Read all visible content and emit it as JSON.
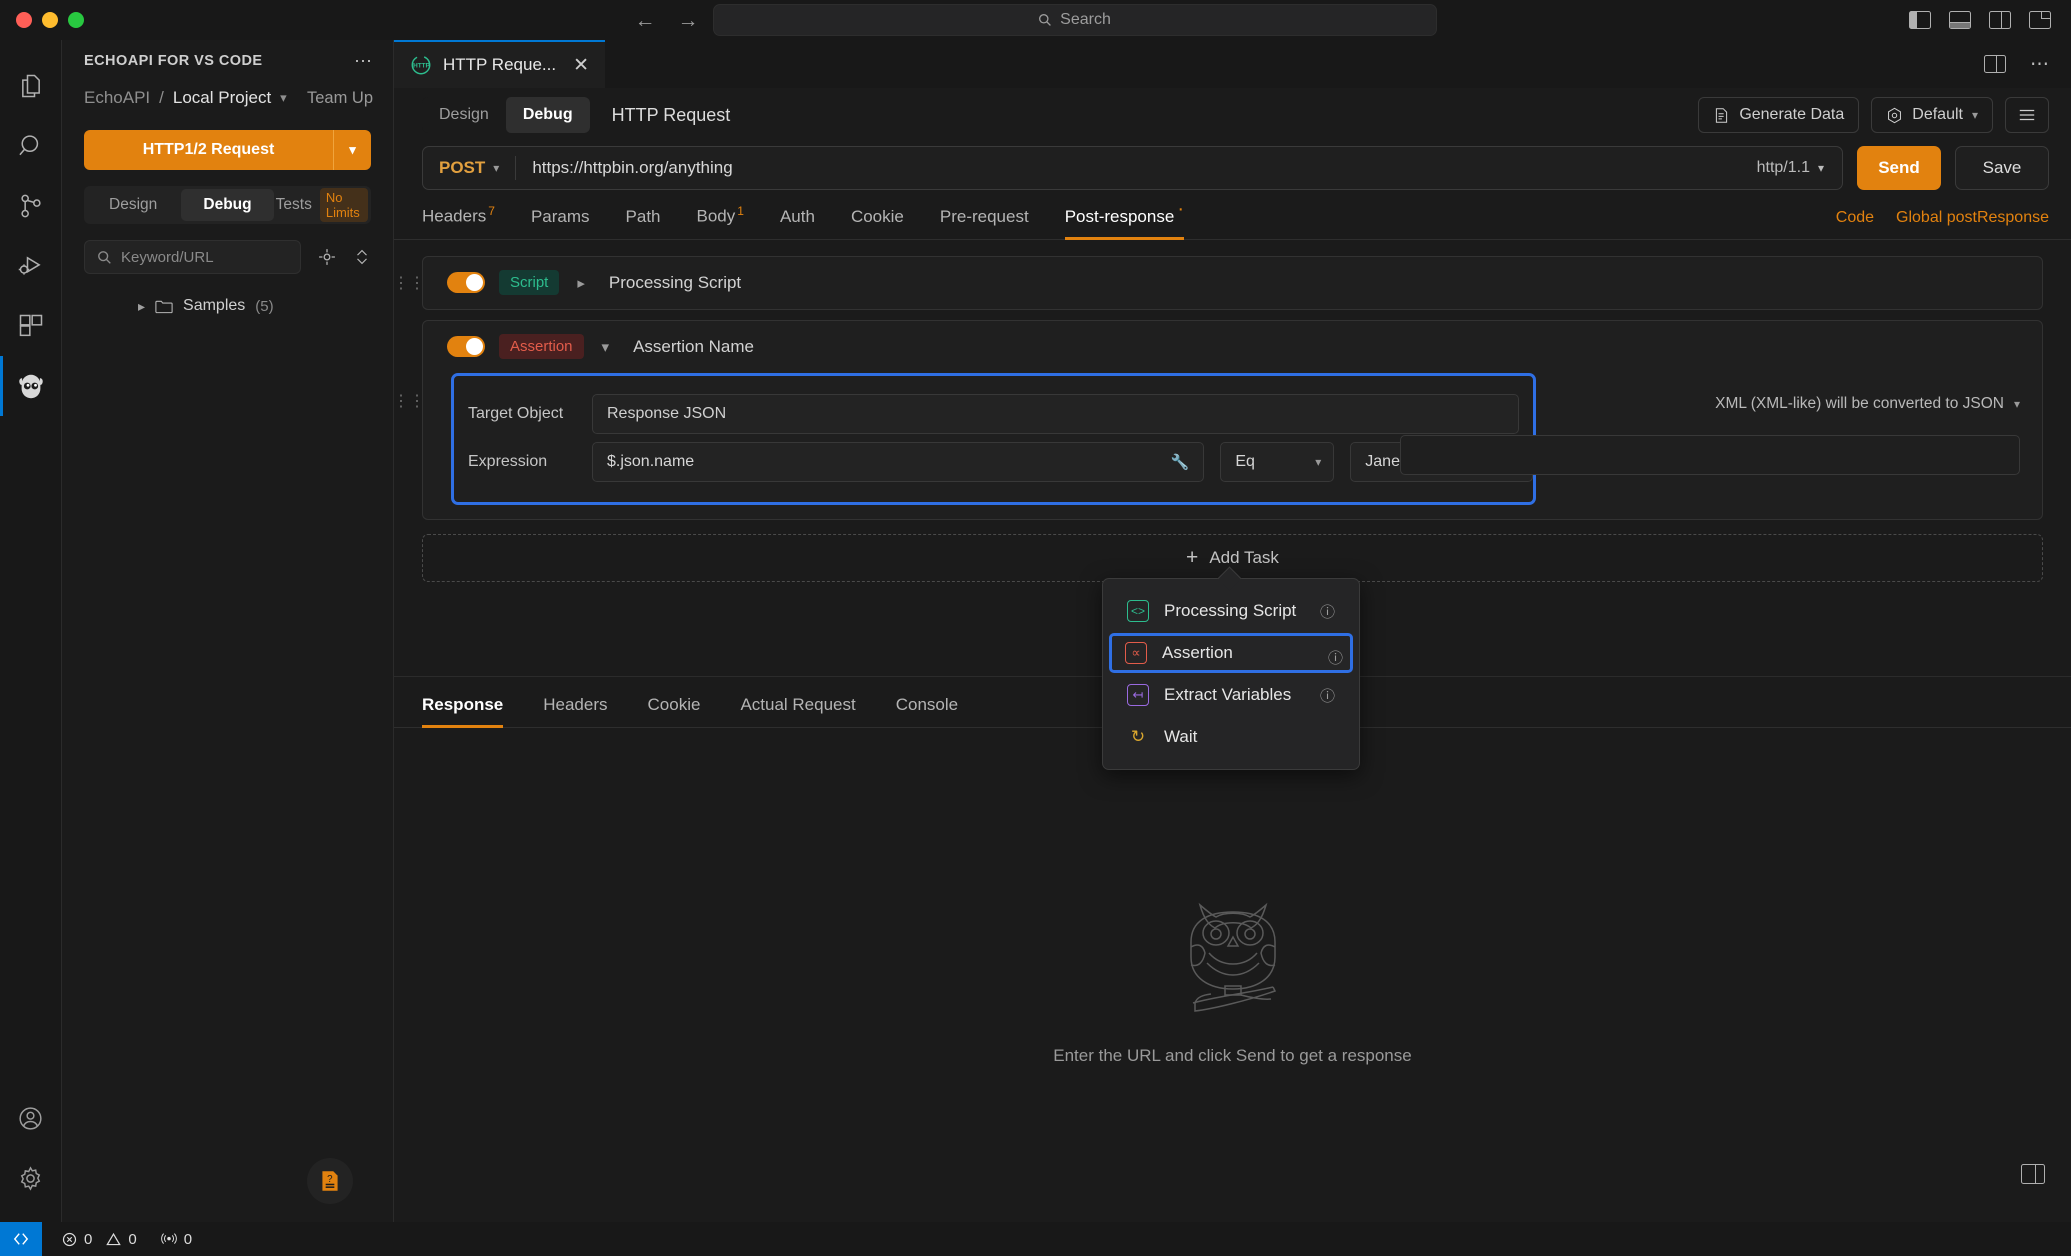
{
  "titlebar": {
    "search_placeholder": "Search",
    "search_icon": "search-icon",
    "back_icon": "arrow-left-icon",
    "forward_icon": "arrow-right-icon"
  },
  "activitybar": {
    "items": [
      {
        "name": "explorer",
        "icon": "files-icon"
      },
      {
        "name": "search",
        "icon": "search-icon"
      },
      {
        "name": "source-control",
        "icon": "source-control-icon"
      },
      {
        "name": "run-and-debug",
        "icon": "run-debug-icon"
      },
      {
        "name": "extensions",
        "icon": "extensions-icon"
      },
      {
        "name": "echoapi",
        "icon": "echoapi-owl-icon"
      }
    ],
    "bottom_items": [
      {
        "name": "accounts",
        "icon": "account-icon"
      },
      {
        "name": "manage",
        "icon": "gear-icon"
      }
    ]
  },
  "sidebar": {
    "title": "ECHOAPI FOR VS CODE",
    "more_icon": "more-horizontal-icon",
    "breadcrumb": {
      "org": "EchoAPI",
      "separator": "/",
      "project": "Local Project",
      "caret": "chevron-down-icon"
    },
    "team_up": "Team Up",
    "new_request_button": "HTTP1/2 Request",
    "segments": [
      {
        "label": "Design",
        "active": false
      },
      {
        "label": "Debug",
        "active": true
      },
      {
        "label": "Tests",
        "active": false,
        "badge": "No Limits"
      }
    ],
    "search_placeholder": "Keyword/URL",
    "search_icon": "search-icon",
    "locate_icon": "crosshair-icon",
    "sort_icon": "sort-updown-icon",
    "tree": [
      {
        "label": "Samples",
        "count": "(5)",
        "chevron": "chevron-right-icon",
        "folder_icon": "folder-icon"
      }
    ],
    "help_icon": "help-doc-icon"
  },
  "editor": {
    "tab": {
      "label": "HTTP Reque...",
      "icon": "http-icon",
      "close_icon": "close-icon"
    },
    "tab_right_icons": [
      "split-editor-icon",
      "more-horizontal-icon"
    ],
    "mode_segments": [
      {
        "label": "Design",
        "active": false
      },
      {
        "label": "Debug",
        "active": true
      }
    ],
    "request_title": "HTTP Request",
    "generate_data_button": "Generate Data",
    "generate_data_icon": "generate-data-icon",
    "environment_button": "Default",
    "environment_icon": "environment-icon",
    "menu_icon": "hamburger-icon",
    "url": {
      "method": "POST",
      "method_caret": "chevron-down-icon",
      "value": "https://httpbin.org/anything",
      "protocol": "http/1.1",
      "protocol_caret": "chevron-down-icon",
      "send_button": "Send",
      "save_button": "Save"
    },
    "request_tabs": [
      {
        "label": "Headers",
        "sup": "7",
        "active": false
      },
      {
        "label": "Params",
        "sup": "",
        "active": false
      },
      {
        "label": "Path",
        "sup": "",
        "active": false
      },
      {
        "label": "Body",
        "sup": "1",
        "active": false
      },
      {
        "label": "Auth",
        "sup": "",
        "active": false
      },
      {
        "label": "Cookie",
        "sup": "",
        "active": false
      },
      {
        "label": "Pre-request",
        "sup": "",
        "active": false
      },
      {
        "label": "Post-response",
        "sup": "",
        "dot": true,
        "active": true
      }
    ],
    "request_tabs_right": [
      {
        "label": "Code"
      },
      {
        "label": "Global postResponse"
      }
    ]
  },
  "post_response": {
    "tasks": [
      {
        "type": "script",
        "chip": "Script",
        "name": "Processing Script",
        "enabled": true,
        "chevron": "chevron-right-icon",
        "grip_icon": "drag-handle-icon"
      },
      {
        "type": "assertion",
        "chip": "Assertion",
        "name": "Assertion Name",
        "enabled": true,
        "chevron": "chevron-down-icon",
        "grip_icon": "drag-handle-icon",
        "fields": {
          "target_object_label": "Target Object",
          "target_object_value": "Response JSON",
          "expression_label": "Expression",
          "expression_value": "$.json.name",
          "expression_tool_icon": "wrench-icon",
          "operator": "Eq",
          "operator_caret": "chevron-down-icon",
          "expected_value": "Jane Smith",
          "note": "XML (XML-like) will be converted to JSON",
          "note_caret": "chevron-down-icon"
        }
      }
    ],
    "add_task_label": "Add Task",
    "add_task_icon": "plus-icon",
    "menu": {
      "items": [
        {
          "label": "Processing Script",
          "icon": "code-brackets-icon",
          "icon_color": "#2dbd8e",
          "help": "?",
          "selected": false
        },
        {
          "label": "Assertion",
          "icon": "assertion-icon",
          "icon_color": "#e25c4a",
          "help": "?",
          "selected": true
        },
        {
          "label": "Extract Variables",
          "icon": "extract-icon",
          "icon_color": "#9a6ae0",
          "help": "?",
          "selected": false
        },
        {
          "label": "Wait",
          "icon": "clock-history-icon",
          "icon_color": "#d9a62e",
          "help": "",
          "selected": false
        }
      ]
    }
  },
  "response": {
    "tabs": [
      {
        "label": "Response",
        "active": true
      },
      {
        "label": "Headers",
        "active": false
      },
      {
        "label": "Cookie",
        "active": false
      },
      {
        "label": "Actual Request",
        "active": false
      },
      {
        "label": "Console",
        "active": false
      }
    ],
    "empty_message": "Enter the URL and click Send to get a response",
    "empty_icon": "owl-illustration",
    "corner_icon": "panel-layout-icon"
  },
  "statusbar": {
    "remote_icon": "remote-window-icon",
    "items": [
      {
        "icon": "error-icon",
        "value": "0"
      },
      {
        "icon": "warning-icon",
        "value": "0"
      },
      {
        "icon": "ports-icon",
        "value": "0"
      }
    ]
  },
  "colors": {
    "accent_orange": "#e2820f",
    "selection_blue": "#2f6fe4",
    "script_green": "#2dbd8e",
    "assertion_red": "#e25c4a",
    "vscode_blue": "#0078d4"
  }
}
